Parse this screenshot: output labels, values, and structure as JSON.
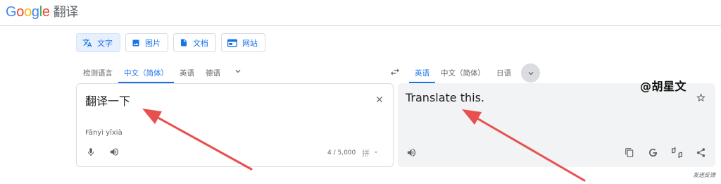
{
  "header": {
    "logo_text": "Google",
    "product": "翻译"
  },
  "modes": [
    {
      "label": "文字",
      "icon": "translate-icon",
      "active": true
    },
    {
      "label": "图片",
      "icon": "image-icon",
      "active": false
    },
    {
      "label": "文档",
      "icon": "document-icon",
      "active": false
    },
    {
      "label": "网站",
      "icon": "website-icon",
      "active": false
    }
  ],
  "source_langs": [
    "检测语言",
    "中文（简体）",
    "英语",
    "德语"
  ],
  "target_langs": [
    "英语",
    "中文（简体）",
    "日语"
  ],
  "source": {
    "text": "翻译一下",
    "transliteration": "Fānyì yīxià",
    "counter": "4 / 5,000",
    "ime_label": "拼"
  },
  "target": {
    "text": "Translate this."
  },
  "watermark": "@胡星文",
  "feedback": "发送反馈",
  "colors": {
    "accent": "#1a73e8",
    "annotation_arrow": "#e85050"
  }
}
